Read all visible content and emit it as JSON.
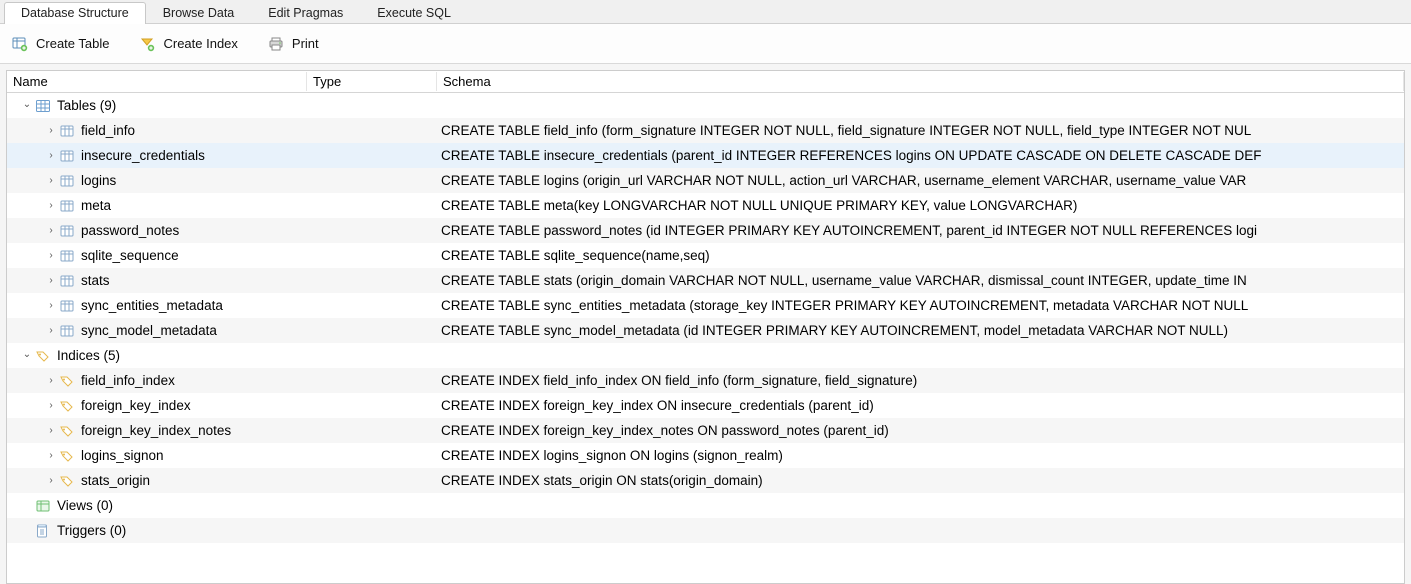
{
  "tabs": {
    "database_structure": "Database Structure",
    "browse_data": "Browse Data",
    "edit_pragmas": "Edit Pragmas",
    "execute_sql": "Execute SQL"
  },
  "toolbar": {
    "create_table": "Create Table",
    "create_index": "Create Index",
    "print": "Print"
  },
  "columns": {
    "name": "Name",
    "type": "Type",
    "schema": "Schema"
  },
  "groups": {
    "tables": {
      "label": "Tables (9)",
      "expanded": true
    },
    "indices": {
      "label": "Indices (5)",
      "expanded": true
    },
    "views": {
      "label": "Views (0)"
    },
    "triggers": {
      "label": "Triggers (0)"
    }
  },
  "tables": [
    {
      "name": "field_info",
      "schema": "CREATE TABLE field_info (form_signature INTEGER NOT NULL, field_signature INTEGER NOT NULL, field_type INTEGER NOT NUL"
    },
    {
      "name": "insecure_credentials",
      "selected": true,
      "schema": "CREATE TABLE insecure_credentials (parent_id INTEGER REFERENCES logins ON UPDATE CASCADE ON DELETE CASCADE DEF"
    },
    {
      "name": "logins",
      "schema": "CREATE TABLE logins (origin_url VARCHAR NOT NULL, action_url VARCHAR, username_element VARCHAR, username_value VAR"
    },
    {
      "name": "meta",
      "schema": "CREATE TABLE meta(key LONGVARCHAR NOT NULL UNIQUE PRIMARY KEY, value LONGVARCHAR)"
    },
    {
      "name": "password_notes",
      "schema": "CREATE TABLE password_notes (id INTEGER PRIMARY KEY AUTOINCREMENT, parent_id INTEGER NOT NULL REFERENCES logi"
    },
    {
      "name": "sqlite_sequence",
      "schema": "CREATE TABLE sqlite_sequence(name,seq)"
    },
    {
      "name": "stats",
      "schema": "CREATE TABLE stats (origin_domain VARCHAR NOT NULL, username_value VARCHAR, dismissal_count INTEGER, update_time IN"
    },
    {
      "name": "sync_entities_metadata",
      "schema": "CREATE TABLE sync_entities_metadata (storage_key INTEGER PRIMARY KEY AUTOINCREMENT, metadata VARCHAR NOT NULL"
    },
    {
      "name": "sync_model_metadata",
      "schema": "CREATE TABLE sync_model_metadata (id INTEGER PRIMARY KEY AUTOINCREMENT, model_metadata VARCHAR NOT NULL)"
    }
  ],
  "indices": [
    {
      "name": "field_info_index",
      "schema": "CREATE INDEX field_info_index ON field_info (form_signature, field_signature)"
    },
    {
      "name": "foreign_key_index",
      "schema": "CREATE INDEX foreign_key_index ON insecure_credentials (parent_id)"
    },
    {
      "name": "foreign_key_index_notes",
      "schema": "CREATE INDEX foreign_key_index_notes ON password_notes (parent_id)"
    },
    {
      "name": "logins_signon",
      "schema": "CREATE INDEX logins_signon ON logins (signon_realm)"
    },
    {
      "name": "stats_origin",
      "schema": "CREATE INDEX stats_origin ON stats(origin_domain)"
    }
  ]
}
